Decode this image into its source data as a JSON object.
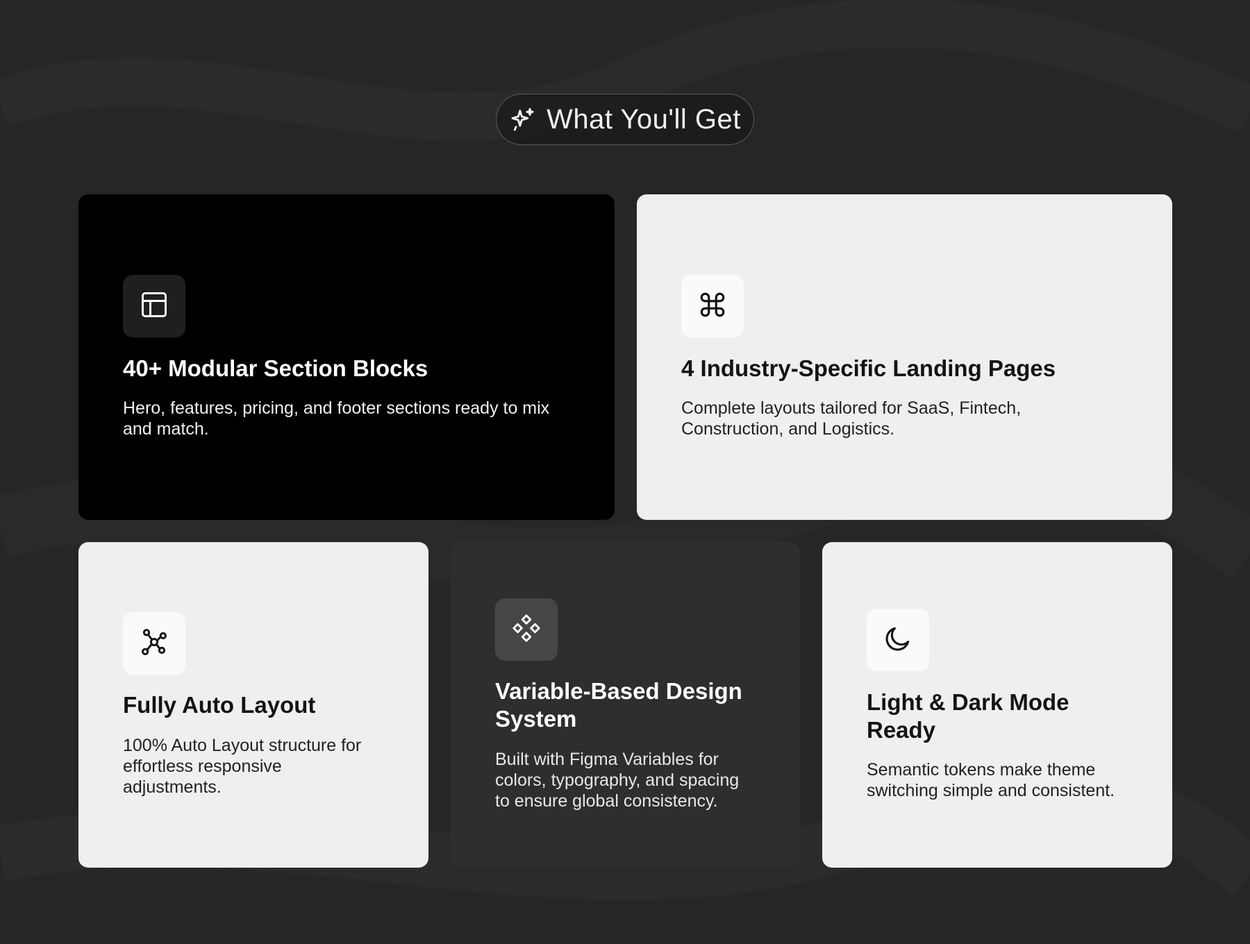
{
  "header": {
    "title": "What You'll Get",
    "icon": "sparkles-icon"
  },
  "colors": {
    "background": "#262626",
    "card_dark": "#000000",
    "card_light": "#efefef",
    "card_mid": "#2e2e2e"
  },
  "cards": [
    {
      "icon": "layout-icon",
      "title": "40+ Modular Section Blocks",
      "description": "Hero, features, pricing, and footer sections ready to mix\nand match."
    },
    {
      "icon": "command-icon",
      "title": "4 Industry-Specific Landing Pages",
      "description": "Complete layouts tailored for SaaS, Fintech,\nConstruction, and Logistics."
    },
    {
      "icon": "network-icon",
      "title": "Fully Auto Layout",
      "description": "100% Auto Layout structure for\neffortless  responsive\nadjustments."
    },
    {
      "icon": "components-icon",
      "title": "Variable-Based Design System",
      "description": "Built with Figma Variables for\ncolors, typography, and spacing\nto ensure global consistency."
    },
    {
      "icon": "moon-icon",
      "title": "Light & Dark Mode Ready",
      "description": "Semantic tokens make theme\nswitching simple and consistent."
    }
  ]
}
